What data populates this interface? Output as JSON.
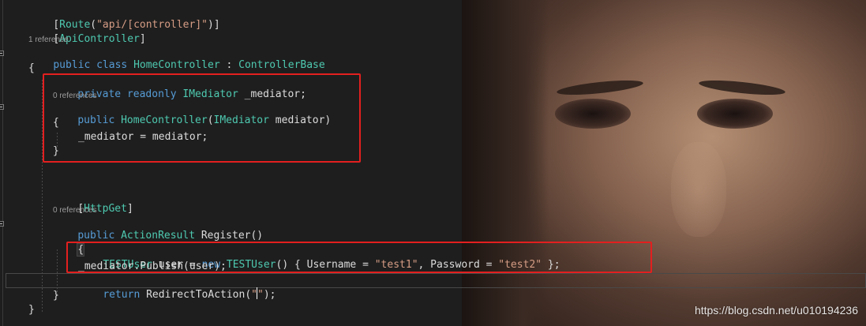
{
  "code": {
    "attr1": {
      "open": "[",
      "name": "Route",
      "open_paren": "(",
      "value": "\"api/[controller]\"",
      "close": ")]"
    },
    "attr2": {
      "open": "[",
      "name": "ApiController",
      "close": "]"
    },
    "class_refs": "1 reference",
    "class_line": {
      "public": "public",
      "class": "class",
      "name": "HomeController",
      "colon": ":",
      "base": "ControllerBase"
    },
    "brace_open_1": "{",
    "field_line": {
      "private": "private",
      "readonly": "readonly",
      "type": "IMediator",
      "name": "_mediator;"
    },
    "ctor_refs": "0 references",
    "ctor_line": {
      "public": "public",
      "name": "HomeController",
      "paren": "(",
      "type": "IMediator",
      "param": "mediator)"
    },
    "ctor_open": "{",
    "assign_line": "_mediator = mediator;",
    "ctor_close": "}",
    "attr3": {
      "open": "[",
      "name": "HttpGet",
      "close": "]"
    },
    "method_refs": "0 references",
    "method_line": {
      "public": "public",
      "type": "ActionResult",
      "name": "Register()"
    },
    "method_open": "{",
    "user_line": {
      "type1": "TESTUser",
      "middle": "user =",
      "new": "new",
      "type2": "TESTUser",
      "paren": "() { Username =",
      "username": "\"test1\"",
      "comma": ", Password =",
      "password": "\"test2\"",
      "end": "};"
    },
    "publish_line": "_mediator.Publish(user);",
    "return_line": {
      "keyword": "return",
      "call": "RedirectToAction(",
      "quote_open": "\"",
      "quote_close": "\"",
      "end": ");"
    },
    "method_close": "}",
    "class_close": "}"
  },
  "watermark": "https://blog.csdn.net/u010194236",
  "colors": {
    "keyword": "#569cd6",
    "type": "#4ec9b0",
    "string": "#d69d85",
    "plain": "#dcdcdc",
    "annotation_box": "#e31f1f",
    "background": "#1e1e1e"
  }
}
